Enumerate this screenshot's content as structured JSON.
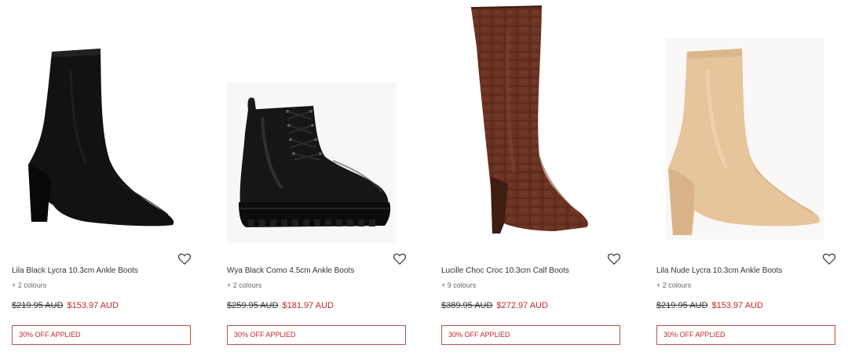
{
  "products": [
    {
      "name": "Lila Black Lycra 10.3cm Ankle Boots",
      "colours": "+ 2 colours",
      "was_price": "$219.95 AUD",
      "now_price": "$153.97 AUD",
      "badge": "30% OFF APPLIED",
      "image": "black-lycra-sock-ankle-boot"
    },
    {
      "name": "Wya Black Como 4.5cm Ankle Boots",
      "colours": "+ 2 colours",
      "was_price": "$259.95 AUD",
      "now_price": "$181.97 AUD",
      "badge": "30% OFF APPLIED",
      "image": "black-leather-lace-up-combat-boot"
    },
    {
      "name": "Lucille Choc Croc 10.3cm Calf Boots",
      "colours": "+ 9 colours",
      "was_price": "$389.95 AUD",
      "now_price": "$272.97 AUD",
      "badge": "30% OFF APPLIED",
      "image": "brown-croc-knee-high-boot"
    },
    {
      "name": "Lila Nude Lycra 10.3cm Ankle Boots",
      "colours": "+ 2 colours",
      "was_price": "$219.95 AUD",
      "now_price": "$153.97 AUD",
      "badge": "30% OFF APPLIED",
      "image": "nude-lycra-sock-ankle-boot"
    }
  ],
  "icons": {
    "wishlist": "heart-icon"
  },
  "colors": {
    "sale_price": "#c0282d",
    "badge_border": "#c0504d",
    "text": "#333333"
  }
}
